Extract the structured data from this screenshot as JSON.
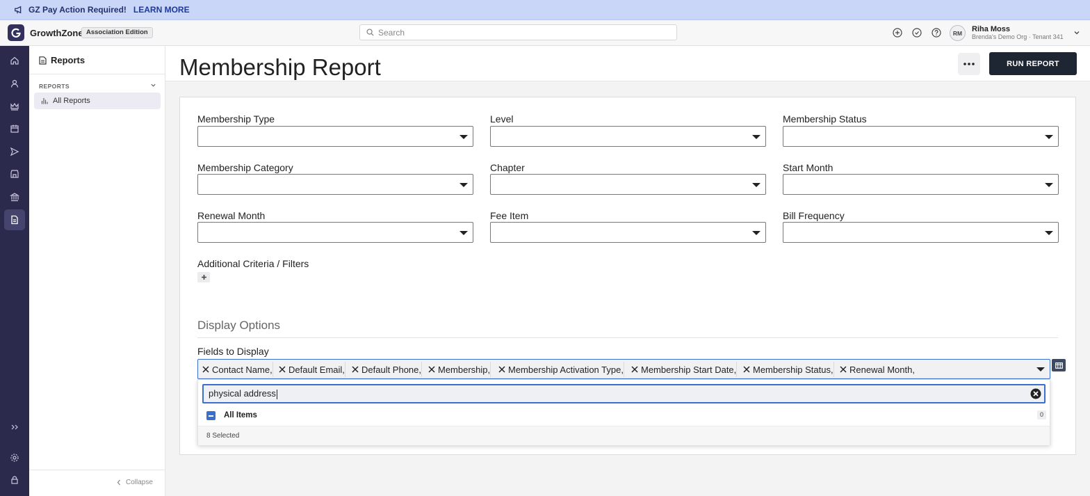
{
  "banner": {
    "message": "GZ Pay Action Required!",
    "link": "LEARN MORE"
  },
  "header": {
    "brand": "GrowthZone",
    "edition": "Association Edition",
    "search_placeholder": "Search",
    "user": {
      "initials": "RM",
      "name": "Riha Moss",
      "org": "Brenda's Demo Org · Tenant 341"
    }
  },
  "sidebar": {
    "title": "Reports",
    "section": "REPORTS",
    "items": [
      {
        "label": "All Reports"
      }
    ],
    "collapse_label": "Collapse"
  },
  "page": {
    "title": "Membership Report",
    "run_button": "RUN REPORT"
  },
  "filters": {
    "membership_type": "Membership Type",
    "level": "Level",
    "membership_status": "Membership Status",
    "membership_category": "Membership Category",
    "chapter": "Chapter",
    "start_month": "Start Month",
    "renewal_month": "Renewal Month",
    "fee_item": "Fee Item",
    "bill_frequency": "Bill Frequency",
    "additional": "Additional Criteria / Filters"
  },
  "display": {
    "title": "Display Options",
    "fields_label": "Fields to Display",
    "tags": [
      "Contact Name,",
      "Default Email,",
      "Default Phone,",
      "Membership,",
      "Membership Activation Type,",
      "Membership Start Date,",
      "Membership Status,",
      "Renewal Month,"
    ],
    "search_value": "physical address",
    "all_items_label": "All Items",
    "all_items_count": "0",
    "selected_text": "8 Selected"
  }
}
